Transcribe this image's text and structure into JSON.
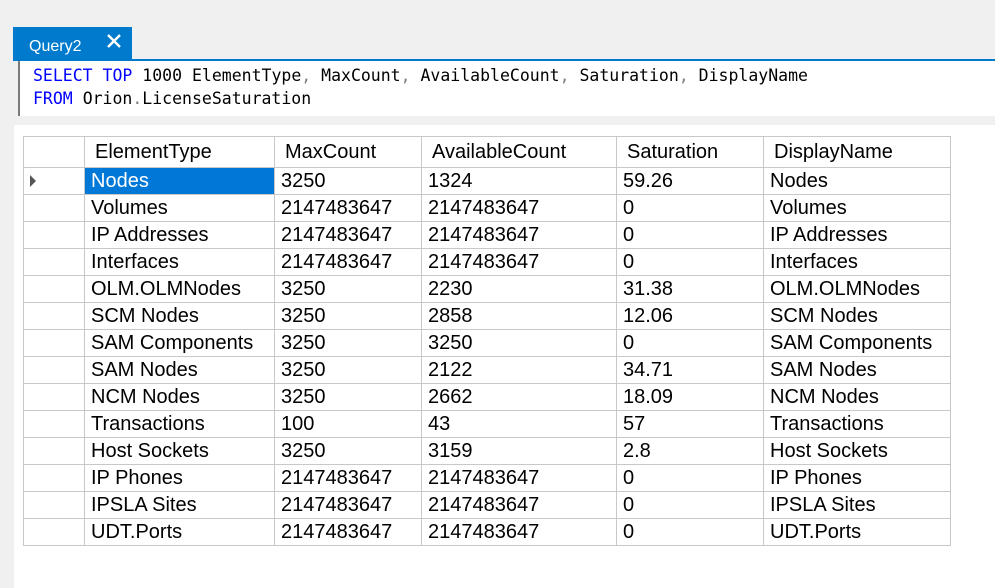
{
  "tab": {
    "title": "Query2",
    "close_icon": "close-icon",
    "color": "#007acc"
  },
  "editor": {
    "line1": {
      "k1": "SELECT",
      "k2": "TOP",
      "n": "1000",
      "c1": "ElementType",
      "c2": "MaxCount",
      "c3": "AvailableCount",
      "c4": "Saturation",
      "c5": "DisplayName",
      "sep": ","
    },
    "line2": {
      "k": "FROM",
      "schema": "Orion",
      "dot": ".",
      "table": "LicenseSaturation"
    },
    "keyword_color": "#0000ff"
  },
  "results": {
    "columns": [
      "ElementType",
      "MaxCount",
      "AvailableCount",
      "Saturation",
      "DisplayName"
    ],
    "row_indicator_icon": "current-row-arrow-icon",
    "selection_color": "#0078d7",
    "rows": [
      [
        "Nodes",
        "3250",
        "1324",
        "59.26",
        "Nodes"
      ],
      [
        "Volumes",
        "2147483647",
        "2147483647",
        "0",
        "Volumes"
      ],
      [
        "IP Addresses",
        "2147483647",
        "2147483647",
        "0",
        "IP Addresses"
      ],
      [
        "Interfaces",
        "2147483647",
        "2147483647",
        "0",
        "Interfaces"
      ],
      [
        "OLM.OLMNodes",
        "3250",
        "2230",
        "31.38",
        "OLM.OLMNodes"
      ],
      [
        "SCM Nodes",
        "3250",
        "2858",
        "12.06",
        "SCM Nodes"
      ],
      [
        "SAM Components",
        "3250",
        "3250",
        "0",
        "SAM Components"
      ],
      [
        "SAM Nodes",
        "3250",
        "2122",
        "34.71",
        "SAM Nodes"
      ],
      [
        "NCM Nodes",
        "3250",
        "2662",
        "18.09",
        "NCM Nodes"
      ],
      [
        "Transactions",
        "100",
        "43",
        "57",
        "Transactions"
      ],
      [
        "Host Sockets",
        "3250",
        "3159",
        "2.8",
        "Host Sockets"
      ],
      [
        "IP Phones",
        "2147483647",
        "2147483647",
        "0",
        "IP Phones"
      ],
      [
        "IPSLA Sites",
        "2147483647",
        "2147483647",
        "0",
        "IPSLA Sites"
      ],
      [
        "UDT.Ports",
        "2147483647",
        "2147483647",
        "0",
        "UDT.Ports"
      ]
    ]
  }
}
